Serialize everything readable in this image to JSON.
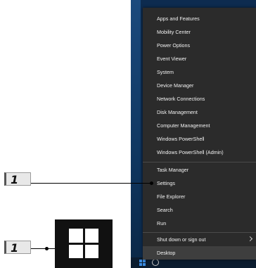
{
  "callouts": [
    "1",
    "1"
  ],
  "menu": {
    "groups": [
      [
        "Apps and Features",
        "Mobility Center",
        "Power Options",
        "Event Viewer",
        "System",
        "Device Manager",
        "Network Connections",
        "Disk Management",
        "Computer Management",
        "Windows PowerShell",
        "Windows PowerShell (Admin)"
      ],
      [
        "Task Manager",
        "Settings",
        "File Explorer",
        "Search",
        "Run"
      ],
      [
        "Shut down or sign out",
        "Desktop"
      ]
    ]
  },
  "icons": {
    "start_tile": "windows-logo-icon",
    "submenu": "chevron-right-icon"
  },
  "colors": {
    "menu_bg": "#2b2b2b",
    "menu_text": "#f2f2f2",
    "desktop_bg": "#0d2b4f"
  }
}
